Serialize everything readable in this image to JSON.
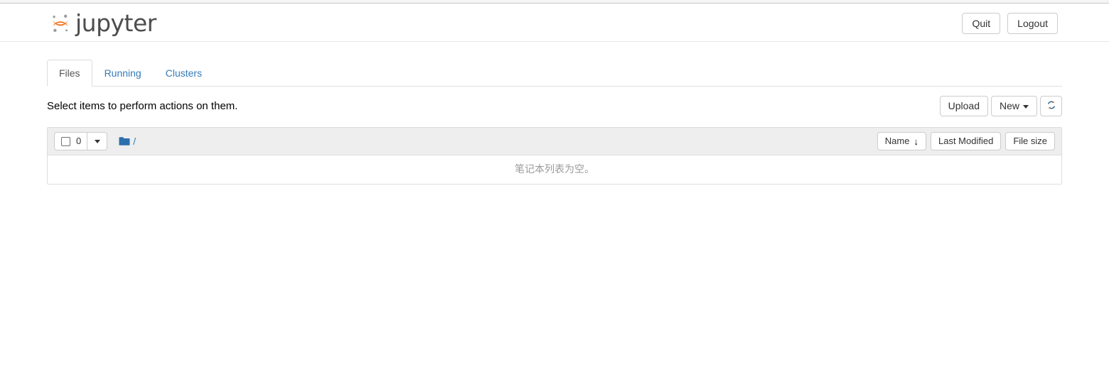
{
  "header": {
    "brand_name": "jupyter",
    "logo_icon": "jupyter-logo",
    "buttons": [
      {
        "label": "Quit",
        "name": "quit-button"
      },
      {
        "label": "Logout",
        "name": "logout-button"
      }
    ]
  },
  "tabs": [
    {
      "label": "Files",
      "active": true
    },
    {
      "label": "Running",
      "active": false
    },
    {
      "label": "Clusters",
      "active": false
    }
  ],
  "toolbar": {
    "hint_text": "Select items to perform actions on them.",
    "upload_label": "Upload",
    "new_label": "New",
    "new_caret_icon": "chevron-down-icon",
    "refresh_icon": "refresh-icon"
  },
  "list_header": {
    "select_all_checkbox": "unchecked",
    "selected_count": "0",
    "select_caret_icon": "chevron-down-icon",
    "folder_icon": "folder-icon",
    "breadcrumb_path": "/",
    "sort_buttons": [
      {
        "label": "Name",
        "arrow": "↓",
        "sorted": true
      },
      {
        "label": "Last Modified",
        "arrow": "",
        "sorted": false
      },
      {
        "label": "File size",
        "arrow": "",
        "sorted": false
      }
    ]
  },
  "list_body": {
    "empty_message": "笔记本列表为空。"
  },
  "colors": {
    "link": "#337ab7",
    "logo_orange": "#f37726",
    "folder_blue": "#2c6fad",
    "header_bg": "#ffffff",
    "list_header_bg": "#eeeeee",
    "border": "#dddddd",
    "empty_text": "#9a9a9a"
  }
}
